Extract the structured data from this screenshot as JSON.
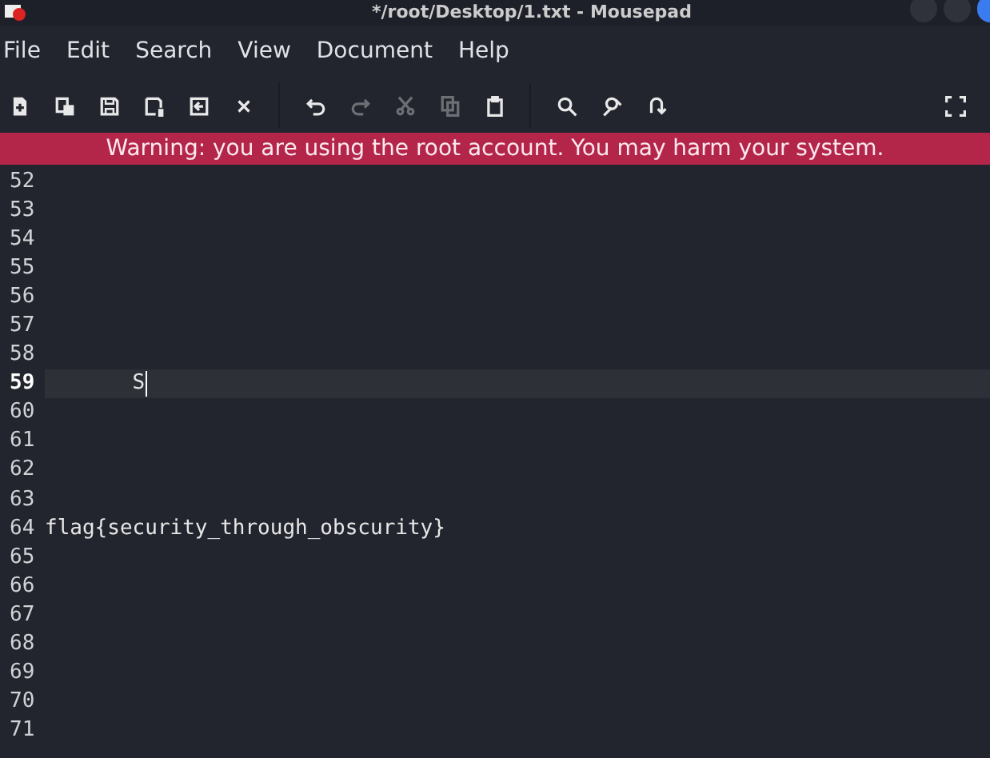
{
  "window": {
    "title": "*/root/Desktop/1.txt - Mousepad"
  },
  "menu": [
    "File",
    "Edit",
    "Search",
    "View",
    "Document",
    "Help"
  ],
  "toolbar": [
    {
      "disabled": false
    },
    {
      "disabled": false
    },
    {
      "disabled": false
    },
    {
      "disabled": false
    },
    {
      "disabled": false
    },
    {
      "disabled": false
    },
    {
      "disabled": false
    },
    {
      "disabled": true
    },
    {
      "disabled": true
    },
    {
      "disabled": true
    },
    {
      "disabled": false
    },
    {
      "disabled": false
    },
    {
      "disabled": false
    },
    {
      "disabled": false
    },
    {
      "disabled": false
    }
  ],
  "warning": "Warning: you are using the root account. You may harm your system.",
  "lines": [
    {
      "number": "52",
      "current": false
    },
    {
      "number": "53",
      "current": false
    },
    {
      "number": "54",
      "current": false
    },
    {
      "number": "55",
      "current": false
    },
    {
      "number": "56",
      "current": false
    },
    {
      "number": "57",
      "current": false
    },
    {
      "number": "58",
      "current": false
    },
    {
      "number": "59",
      "current": true,
      "text": "       S"
    },
    {
      "number": "60",
      "current": false
    },
    {
      "number": "61",
      "current": false
    },
    {
      "number": "62",
      "current": false
    },
    {
      "number": "63",
      "current": false
    },
    {
      "number": "64",
      "current": false,
      "text": "flag{security_through_obscurity}"
    },
    {
      "number": "65",
      "current": false
    },
    {
      "number": "66",
      "current": false
    },
    {
      "number": "67",
      "current": false
    },
    {
      "number": "68",
      "current": false
    },
    {
      "number": "69",
      "current": false
    },
    {
      "number": "70",
      "current": false
    },
    {
      "number": "71",
      "current": false
    }
  ]
}
